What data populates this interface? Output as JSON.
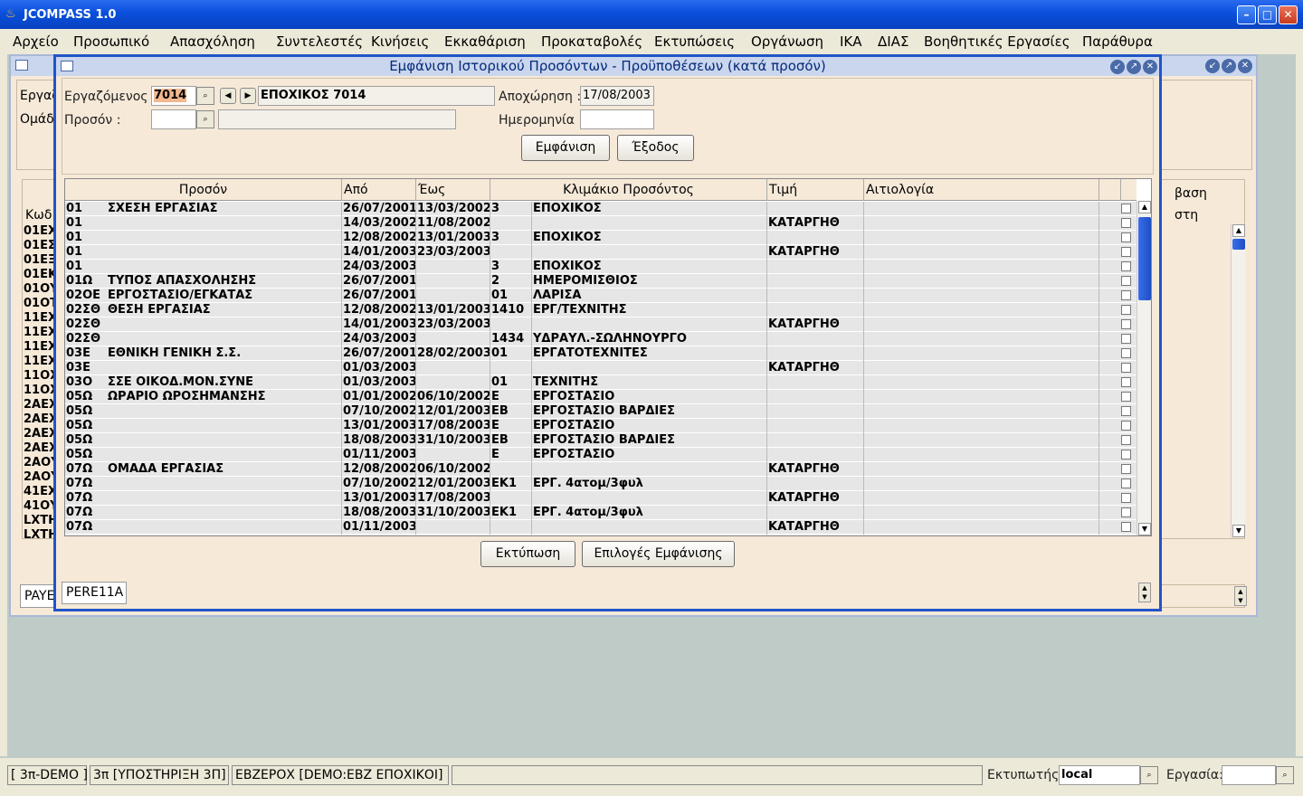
{
  "app": {
    "title": "JCOMPASS 1.0"
  },
  "menu": [
    "Αρχείο",
    "Προσωπικό",
    "Απασχόληση",
    "Συντελεστές",
    "Κινήσεις",
    "Εκκαθάριση",
    "Προκαταβολές",
    "Εκτυπώσεις",
    "Οργάνωση",
    "ΙΚΑ",
    "ΔΙΑΣ",
    "Βοηθητικές Εργασίες",
    "Παράθυρα"
  ],
  "background_window": {
    "labels": [
      "Εργαζ",
      "Ομάδ"
    ],
    "column_fragments": [
      "βαση",
      "στη",
      "Κωδ"
    ],
    "codes": [
      "01ΕΧ",
      "01ΕΣ",
      "01ΕΞ",
      "01ΕΚ",
      "01ΟΥ",
      "01ΟΤ",
      "11ΕΧ",
      "11ΕΧ",
      "11ΕΧ",
      "11ΕΧ",
      "11ΟΧ",
      "11ΟΧ",
      "2ΑΕΧ",
      "2ΑΕΧ",
      "2ΑΕΧ",
      "2ΑΕΧ",
      "2ΑΟΥ",
      "2ΑΟΥ",
      "41ΕΧ",
      "41ΟΥ",
      "LXTH",
      "LXTH"
    ],
    "status": "PAYE"
  },
  "dialog": {
    "title": "Εμφάνιση Ιστορικού Προσόντων - Προϋποθέσεων (κατά προσόν)",
    "employee_label": "Εργαζόμενος :",
    "employee_code": "7014",
    "employee_name": "ΕΠΟΧΙΚΟΣ 7014",
    "departure_label": "Αποχώρηση :",
    "departure_date": "17/08/2003",
    "qualification_label": "Προσόν :",
    "qualification_code": "",
    "qualification_desc": "",
    "date_label": "Ημερομηνία :",
    "date_value": "",
    "show_button": "Εμφάνιση",
    "exit_button": "Έξοδος",
    "print_button": "Εκτύπωση",
    "options_button": "Επιλογές Εμφάνισης",
    "status_code": "PERE11A"
  },
  "table": {
    "columns": [
      "Προσόν",
      "Από",
      "Έως",
      "Κλιμάκιο Προσόντος",
      "Τιμή",
      "Αιτιολογία"
    ],
    "rows": [
      [
        "01",
        "ΣΧΕΣΗ ΕΡΓΑΣΙΑΣ",
        "26/07/2001",
        "13/03/2002",
        "3",
        "ΕΠΟΧΙΚΟΣ",
        ""
      ],
      [
        "01",
        "",
        "14/03/2002",
        "11/08/2002",
        "",
        "",
        "ΚΑΤΑΡΓΗΘ"
      ],
      [
        "01",
        "",
        "12/08/2002",
        "13/01/2003",
        "3",
        "ΕΠΟΧΙΚΟΣ",
        ""
      ],
      [
        "01",
        "",
        "14/01/2003",
        "23/03/2003",
        "",
        "",
        "ΚΑΤΑΡΓΗΘ"
      ],
      [
        "01",
        "",
        "24/03/2003",
        "",
        "3",
        "ΕΠΟΧΙΚΟΣ",
        ""
      ],
      [
        "01Ω",
        "ΤΥΠΟΣ ΑΠΑΣΧΟΛΗΣΗΣ",
        "26/07/2001",
        "",
        "2",
        "ΗΜΕΡΟΜΙΣΘΙΟΣ",
        ""
      ],
      [
        "02ΟΕ",
        "ΕΡΓΟΣΤΑΣΙΟ/ΕΓΚΑΤΑΣ",
        "26/07/2001",
        "",
        "01",
        "ΛΑΡΙΣΑ",
        ""
      ],
      [
        "02ΣΘ",
        "ΘΕΣΗ ΕΡΓΑΣΙΑΣ",
        "12/08/2002",
        "13/01/2003",
        "1410",
        "ΕΡΓ/ΤΕΧΝΙΤΗΣ",
        ""
      ],
      [
        "02ΣΘ",
        "",
        "14/01/2003",
        "23/03/2003",
        "",
        "",
        "ΚΑΤΑΡΓΗΘ"
      ],
      [
        "02ΣΘ",
        "",
        "24/03/2003",
        "",
        "1434",
        "ΥΔΡΑΥΛ.-ΣΩΛΗΝΟΥΡΓΟ",
        ""
      ],
      [
        "03Ε",
        "ΕΘΝΙΚΗ ΓΕΝΙΚΗ Σ.Σ.",
        "26/07/2001",
        "28/02/2003",
        "01",
        "ΕΡΓΑΤΟΤΕΧΝΙΤΕΣ",
        ""
      ],
      [
        "03Ε",
        "",
        "01/03/2003",
        "",
        "",
        "",
        "ΚΑΤΑΡΓΗΘ"
      ],
      [
        "03Ο",
        "ΣΣΕ ΟΙΚΟΔ.ΜΟΝ.ΣΥΝΕ",
        "01/03/2003",
        "",
        "01",
        "ΤΕΧΝΙΤΗΣ",
        ""
      ],
      [
        "05Ω",
        "ΩΡΑΡΙΟ ΩΡΟΣΗΜΑΝΣΗΣ",
        "01/01/2002",
        "06/10/2002",
        "Ε",
        "ΕΡΓΟΣΤΑΣΙΟ",
        ""
      ],
      [
        "05Ω",
        "",
        "07/10/2002",
        "12/01/2003",
        "ΕΒ",
        "ΕΡΓΟΣΤΑΣΙΟ ΒΑΡΔΙΕΣ",
        ""
      ],
      [
        "05Ω",
        "",
        "13/01/2003",
        "17/08/2003",
        "Ε",
        "ΕΡΓΟΣΤΑΣΙΟ",
        ""
      ],
      [
        "05Ω",
        "",
        "18/08/2003",
        "31/10/2003",
        "ΕΒ",
        "ΕΡΓΟΣΤΑΣΙΟ ΒΑΡΔΙΕΣ",
        ""
      ],
      [
        "05Ω",
        "",
        "01/11/2003",
        "",
        "Ε",
        "ΕΡΓΟΣΤΑΣΙΟ",
        ""
      ],
      [
        "07Ω",
        "ΟΜΑΔΑ ΕΡΓΑΣΙΑΣ",
        "12/08/2002",
        "06/10/2002",
        "",
        "",
        "ΚΑΤΑΡΓΗΘ"
      ],
      [
        "07Ω",
        "",
        "07/10/2002",
        "12/01/2003",
        "ΕΚ1",
        "ΕΡΓ. 4ατομ/3φυλ",
        ""
      ],
      [
        "07Ω",
        "",
        "13/01/2003",
        "17/08/2003",
        "",
        "",
        "ΚΑΤΑΡΓΗΘ"
      ],
      [
        "07Ω",
        "",
        "18/08/2003",
        "31/10/2003",
        "ΕΚ1",
        "ΕΡΓ. 4ατομ/3φυλ",
        ""
      ],
      [
        "07Ω",
        "",
        "01/11/2003",
        "",
        "",
        "",
        "ΚΑΤΑΡΓΗΘ"
      ]
    ]
  },
  "statusbar": {
    "company": "[ 3π-DEMO ]",
    "support": "3π [ΥΠΟΣΤΗΡΙΞΗ 3Π]",
    "job": "ΕΒΖΕΡΟΧ [DEMO:ΕΒΖ ΕΠΟΧΙΚΟΙ]",
    "printer_label": "Εκτυπωτής:",
    "printer_value": "local",
    "task_label": "Εργασία:",
    "task_value": ""
  }
}
